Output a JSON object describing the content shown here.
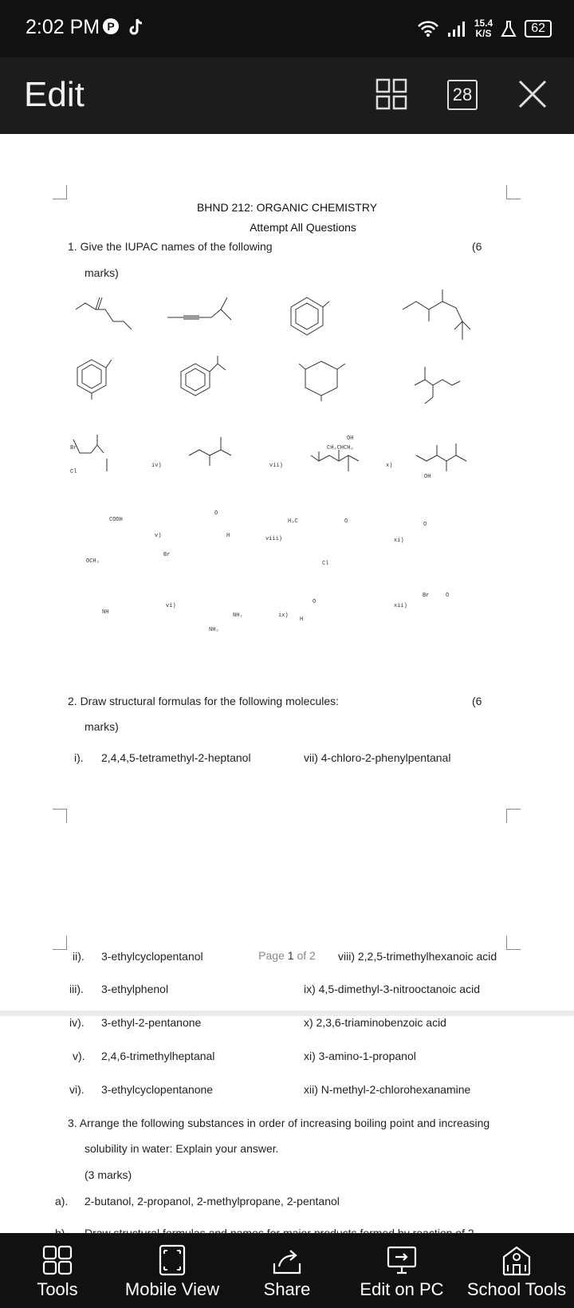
{
  "status_bar": {
    "time": "2:02 PM",
    "net_speed_value": "15.4",
    "net_speed_unit": "K/S",
    "battery": "62"
  },
  "toolbar": {
    "title": "Edit",
    "page_count": "28"
  },
  "document": {
    "heading": "BHND 212: ORGANIC CHEMISTRY",
    "subheading": "Attempt All Questions",
    "q1_text": "1.  Give the IUPAC names of the following",
    "q1_marks": "(6",
    "q1_marks_cont": "marks)",
    "mol_labels": [
      "iv)",
      "vii)",
      "x)",
      "v)",
      "viii)",
      "xi)",
      "vi)",
      "ix)",
      "xii)"
    ],
    "mol_atoms": {
      "br": "Br",
      "cl": "Cl",
      "oh": "OH",
      "ch2chch3": "CH₂CHCH₃",
      "cooh": "COOH",
      "och3": "OCH₃",
      "h3c": "H₃C",
      "nh": "NH",
      "nh2": "NH₂",
      "h": "H",
      "o": "O"
    },
    "q2_text": "2.  Draw structural formulas for the following molecules:",
    "q2_marks": "(6",
    "q2_marks_cont": "marks)",
    "q2_items_left": [
      {
        "num": "i).",
        "text": "2,4,4,5-tetramethyl-2-heptanol"
      },
      {
        "num": "ii).",
        "text": "3-ethylcyclopentanol"
      },
      {
        "num": "iii).",
        "text": "3-ethylphenol"
      },
      {
        "num": "iv).",
        "text": "3-ethyl-2-pentanone"
      },
      {
        "num": "v).",
        "text": "2,4,6-trimethylheptanal"
      },
      {
        "num": "vi).",
        "text": "3-ethylcyclopentanone"
      }
    ],
    "q2_items_right": [
      "vii) 4-chloro-2-phenylpentanal",
      "viii) 2,2,5-trimethylhexanoic acid",
      "ix) 4,5-dimethyl-3-nitrooctanoic acid",
      "x) 2,3,6-triaminobenzoic acid",
      "xi) 3-amino-1-propanol",
      "xii) N-methyl-2-chlorohexanamine"
    ],
    "page_indicator_prefix": "Page ",
    "page_current": "1",
    "page_indicator_suffix": " of 2",
    "q3_text": "3.  Arrange the following substances in order of increasing boiling point and increasing",
    "q3_text_cont": "solubility in water: Explain your answer.",
    "q3_marks": "(3 marks)",
    "q3a_num": "a).",
    "q3a_text": "2-butanol, 2-propanol, 2-methylpropane, 2-pentanol",
    "q3b_num": "b).",
    "q3b_text": "Draw structural formulas and names for major products formed by reaction of 2"
  },
  "bottom_nav": [
    {
      "label": "Tools"
    },
    {
      "label": "Mobile View"
    },
    {
      "label": "Share"
    },
    {
      "label": "Edit on PC"
    },
    {
      "label": "School Tools"
    }
  ]
}
